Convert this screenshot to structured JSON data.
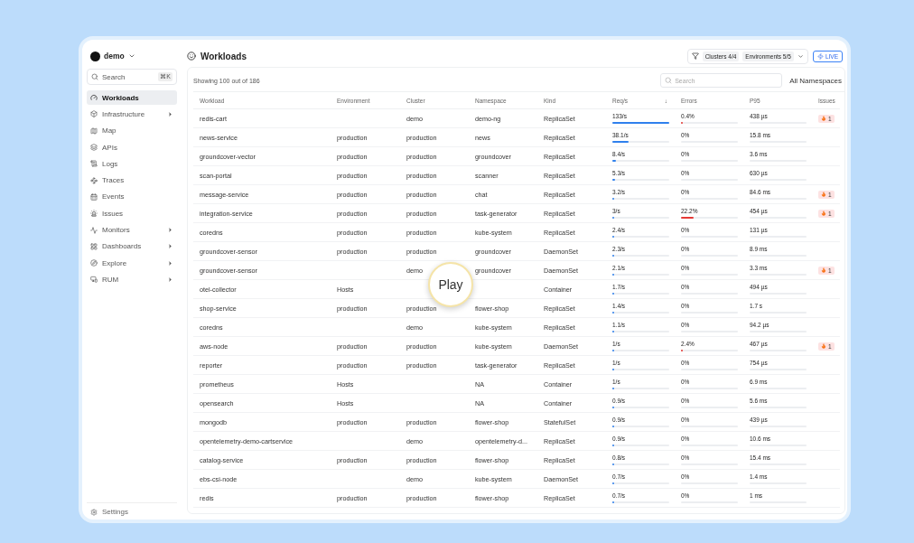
{
  "workspace": {
    "name": "demo"
  },
  "sidebar": {
    "search": {
      "placeholder": "Search",
      "shortcut": "⌘K"
    },
    "items": [
      {
        "label": "Workloads",
        "selected": true,
        "has_submenu": false
      },
      {
        "label": "Infrastructure",
        "selected": false,
        "has_submenu": true
      },
      {
        "label": "Map",
        "selected": false,
        "has_submenu": false
      },
      {
        "label": "APIs",
        "selected": false,
        "has_submenu": false
      },
      {
        "label": "Logs",
        "selected": false,
        "has_submenu": false
      },
      {
        "label": "Traces",
        "selected": false,
        "has_submenu": false
      },
      {
        "label": "Events",
        "selected": false,
        "has_submenu": false
      },
      {
        "label": "Issues",
        "selected": false,
        "has_submenu": false
      },
      {
        "label": "Monitors",
        "selected": false,
        "has_submenu": true
      },
      {
        "label": "Dashboards",
        "selected": false,
        "has_submenu": true
      },
      {
        "label": "Explore",
        "selected": false,
        "has_submenu": true
      },
      {
        "label": "RUM",
        "selected": false,
        "has_submenu": true
      }
    ],
    "footer": "Settings"
  },
  "header": {
    "title": "Workloads",
    "filters": [
      "Clusters 4/4",
      "Environments 5/5"
    ],
    "live": "LIVE"
  },
  "toolbar": {
    "summary": "Showing 100 out of 186",
    "search": {
      "placeholder": "Search"
    },
    "namespace_filter": "All Namespaces"
  },
  "table": {
    "columns": [
      "Workload",
      "Environment",
      "Cluster",
      "Namespace",
      "Kind",
      "Req/s",
      "Errors",
      "P95",
      "Issues"
    ],
    "sort_marker": "↓",
    "rows": [
      {
        "workload": "redis-cart",
        "environment": "",
        "cluster": "demo",
        "namespace": "demo-ng",
        "kind": "ReplicaSet",
        "requests": {
          "value": "133/s",
          "level": 1
        },
        "errors": {
          "value": "0.4%",
          "level": 0.004
        },
        "p95": "438 µs",
        "issues": "1"
      },
      {
        "workload": "news-service",
        "environment": "production",
        "cluster": "production",
        "namespace": "news",
        "kind": "ReplicaSet",
        "requests": {
          "value": "38.1/s",
          "level": 0.29
        },
        "errors": {
          "value": "0%",
          "level": 0
        },
        "p95": "15.8 ms",
        "issues": ""
      },
      {
        "workload": "groundcover-vector",
        "environment": "production",
        "cluster": "production",
        "namespace": "groundcover",
        "kind": "ReplicaSet",
        "requests": {
          "value": "8.4/s",
          "level": 0.063
        },
        "errors": {
          "value": "0%",
          "level": 0
        },
        "p95": "3.6 ms",
        "issues": ""
      },
      {
        "workload": "scan-portal",
        "environment": "production",
        "cluster": "production",
        "namespace": "scanner",
        "kind": "ReplicaSet",
        "requests": {
          "value": "5.3/s",
          "level": 0.04
        },
        "errors": {
          "value": "0%",
          "level": 0
        },
        "p95": "630 µs",
        "issues": ""
      },
      {
        "workload": "message-service",
        "environment": "production",
        "cluster": "production",
        "namespace": "chat",
        "kind": "ReplicaSet",
        "requests": {
          "value": "3.2/s",
          "level": 0.024
        },
        "errors": {
          "value": "0%",
          "level": 0
        },
        "p95": "84.6 ms",
        "issues": "1"
      },
      {
        "workload": "integration-service",
        "environment": "production",
        "cluster": "production",
        "namespace": "task-generator",
        "kind": "ReplicaSet",
        "requests": {
          "value": "3/s",
          "level": 0.023
        },
        "errors": {
          "value": "22.2%",
          "level": 0.222
        },
        "p95": "454 µs",
        "issues": "1"
      },
      {
        "workload": "coredns",
        "environment": "production",
        "cluster": "production",
        "namespace": "kube-system",
        "kind": "ReplicaSet",
        "requests": {
          "value": "2.4/s",
          "level": 0.018
        },
        "errors": {
          "value": "0%",
          "level": 0
        },
        "p95": "131 µs",
        "issues": ""
      },
      {
        "workload": "groundcover-sensor",
        "environment": "production",
        "cluster": "production",
        "namespace": "groundcover",
        "kind": "DaemonSet",
        "requests": {
          "value": "2.3/s",
          "level": 0.017
        },
        "errors": {
          "value": "0%",
          "level": 0
        },
        "p95": "8.9 ms",
        "issues": ""
      },
      {
        "workload": "groundcover-sensor",
        "environment": "",
        "cluster": "demo",
        "namespace": "groundcover",
        "kind": "DaemonSet",
        "requests": {
          "value": "2.1/s",
          "level": 0.016
        },
        "errors": {
          "value": "0%",
          "level": 0
        },
        "p95": "3.3 ms",
        "issues": "1"
      },
      {
        "workload": "otel-collector",
        "environment": "Hosts",
        "cluster": "",
        "namespace": "",
        "kind": "Container",
        "requests": {
          "value": "1.7/s",
          "level": 0.013
        },
        "errors": {
          "value": "0%",
          "level": 0
        },
        "p95": "494 µs",
        "issues": ""
      },
      {
        "workload": "shop-service",
        "environment": "production",
        "cluster": "production",
        "namespace": "flower-shop",
        "kind": "ReplicaSet",
        "requests": {
          "value": "1.4/s",
          "level": 0.011
        },
        "errors": {
          "value": "0%",
          "level": 0
        },
        "p95": "1.7 s",
        "issues": ""
      },
      {
        "workload": "coredns",
        "environment": "",
        "cluster": "demo",
        "namespace": "kube-system",
        "kind": "ReplicaSet",
        "requests": {
          "value": "1.1/s",
          "level": 0.008
        },
        "errors": {
          "value": "0%",
          "level": 0
        },
        "p95": "94.2 µs",
        "issues": ""
      },
      {
        "workload": "aws-node",
        "environment": "production",
        "cluster": "production",
        "namespace": "kube-system",
        "kind": "DaemonSet",
        "requests": {
          "value": "1/s",
          "level": 0.008
        },
        "errors": {
          "value": "2.4%",
          "level": 0.024
        },
        "p95": "467 µs",
        "issues": "1"
      },
      {
        "workload": "reporter",
        "environment": "production",
        "cluster": "production",
        "namespace": "task-generator",
        "kind": "ReplicaSet",
        "requests": {
          "value": "1/s",
          "level": 0.008
        },
        "errors": {
          "value": "0%",
          "level": 0
        },
        "p95": "754 µs",
        "issues": ""
      },
      {
        "workload": "prometheus",
        "environment": "Hosts",
        "cluster": "",
        "namespace": "NA",
        "kind": "Container",
        "requests": {
          "value": "1/s",
          "level": 0.008
        },
        "errors": {
          "value": "0%",
          "level": 0
        },
        "p95": "6.9 ms",
        "issues": ""
      },
      {
        "workload": "opensearch",
        "environment": "Hosts",
        "cluster": "",
        "namespace": "NA",
        "kind": "Container",
        "requests": {
          "value": "0.9/s",
          "level": 0.007
        },
        "errors": {
          "value": "0%",
          "level": 0
        },
        "p95": "5.6 ms",
        "issues": ""
      },
      {
        "workload": "mongodb",
        "environment": "production",
        "cluster": "production",
        "namespace": "flower-shop",
        "kind": "StatefulSet",
        "requests": {
          "value": "0.9/s",
          "level": 0.007
        },
        "errors": {
          "value": "0%",
          "level": 0
        },
        "p95": "439 µs",
        "issues": ""
      },
      {
        "workload": "opentelemetry-demo-cartservice",
        "environment": "",
        "cluster": "demo",
        "namespace": "opentelemetry-d...",
        "kind": "ReplicaSet",
        "requests": {
          "value": "0.9/s",
          "level": 0.007
        },
        "errors": {
          "value": "0%",
          "level": 0
        },
        "p95": "10.6 ms",
        "issues": ""
      },
      {
        "workload": "catalog-service",
        "environment": "production",
        "cluster": "production",
        "namespace": "flower-shop",
        "kind": "ReplicaSet",
        "requests": {
          "value": "0.8/s",
          "level": 0.006
        },
        "errors": {
          "value": "0%",
          "level": 0
        },
        "p95": "15.4 ms",
        "issues": ""
      },
      {
        "workload": "ebs-csi-node",
        "environment": "",
        "cluster": "demo",
        "namespace": "kube-system",
        "kind": "DaemonSet",
        "requests": {
          "value": "0.7/s",
          "level": 0.005
        },
        "errors": {
          "value": "0%",
          "level": 0
        },
        "p95": "1.4 ms",
        "issues": ""
      },
      {
        "workload": "redis",
        "environment": "production",
        "cluster": "production",
        "namespace": "flower-shop",
        "kind": "ReplicaSet",
        "requests": {
          "value": "0.7/s",
          "level": 0.005
        },
        "errors": {
          "value": "0%",
          "level": 0
        },
        "p95": "1 ms",
        "issues": ""
      }
    ]
  },
  "video_overlay": {
    "label": "Play"
  }
}
